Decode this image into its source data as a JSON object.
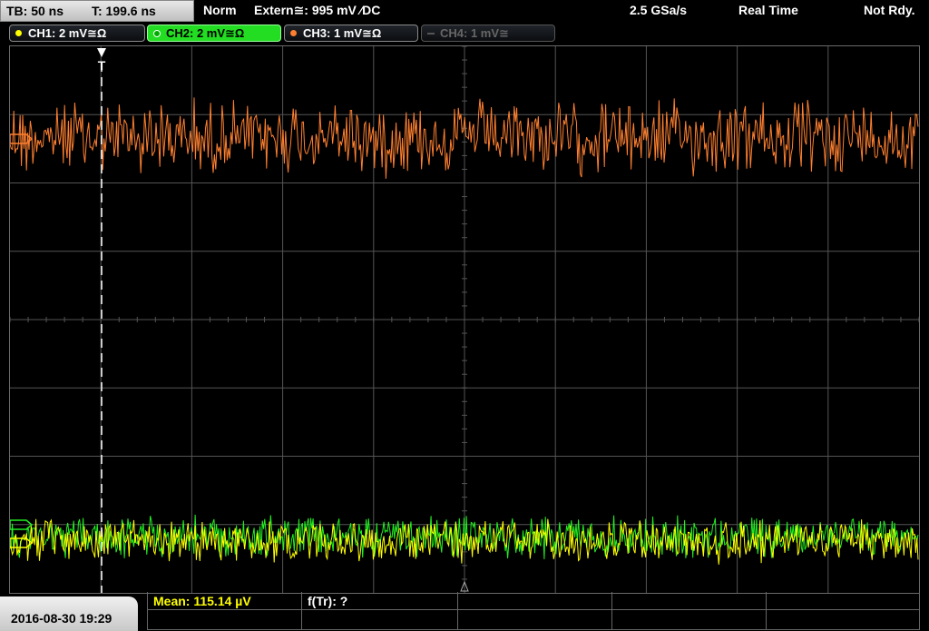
{
  "header": {
    "timebase": "TB: 50 ns",
    "trigger_time": "T: 199.6 ns",
    "trigger_mode": "Norm",
    "trigger_source": "Extern≅: 995 mV ⁄DC",
    "sample_rate": "2.5 GSa/s",
    "acq_mode": "Real Time",
    "status": "Not Rdy."
  },
  "channels": [
    {
      "id": "ch1",
      "label": "CH1: 2 mV≅Ω",
      "color": "#ffff00",
      "state": "on"
    },
    {
      "id": "ch2",
      "label": "CH2: 2 mV≅Ω",
      "color": "#22ee22",
      "state": "selected"
    },
    {
      "id": "ch3",
      "label": "CH3: 1 mV≅Ω",
      "color": "#ff8030",
      "state": "on"
    },
    {
      "id": "ch4",
      "label": "CH4: 1 mV≅",
      "color": "#666666",
      "state": "off"
    }
  ],
  "screen": {
    "trigger_marker": "T",
    "colors": {
      "grid": "#555555",
      "ch1": "#ffff00",
      "ch2": "#22ee22",
      "ch3": "#ff8030"
    }
  },
  "footer": {
    "datetime": "2016-08-30 19:29",
    "mean": "Mean: 115.14 µV",
    "ftr": "f(Tr): ?"
  }
}
